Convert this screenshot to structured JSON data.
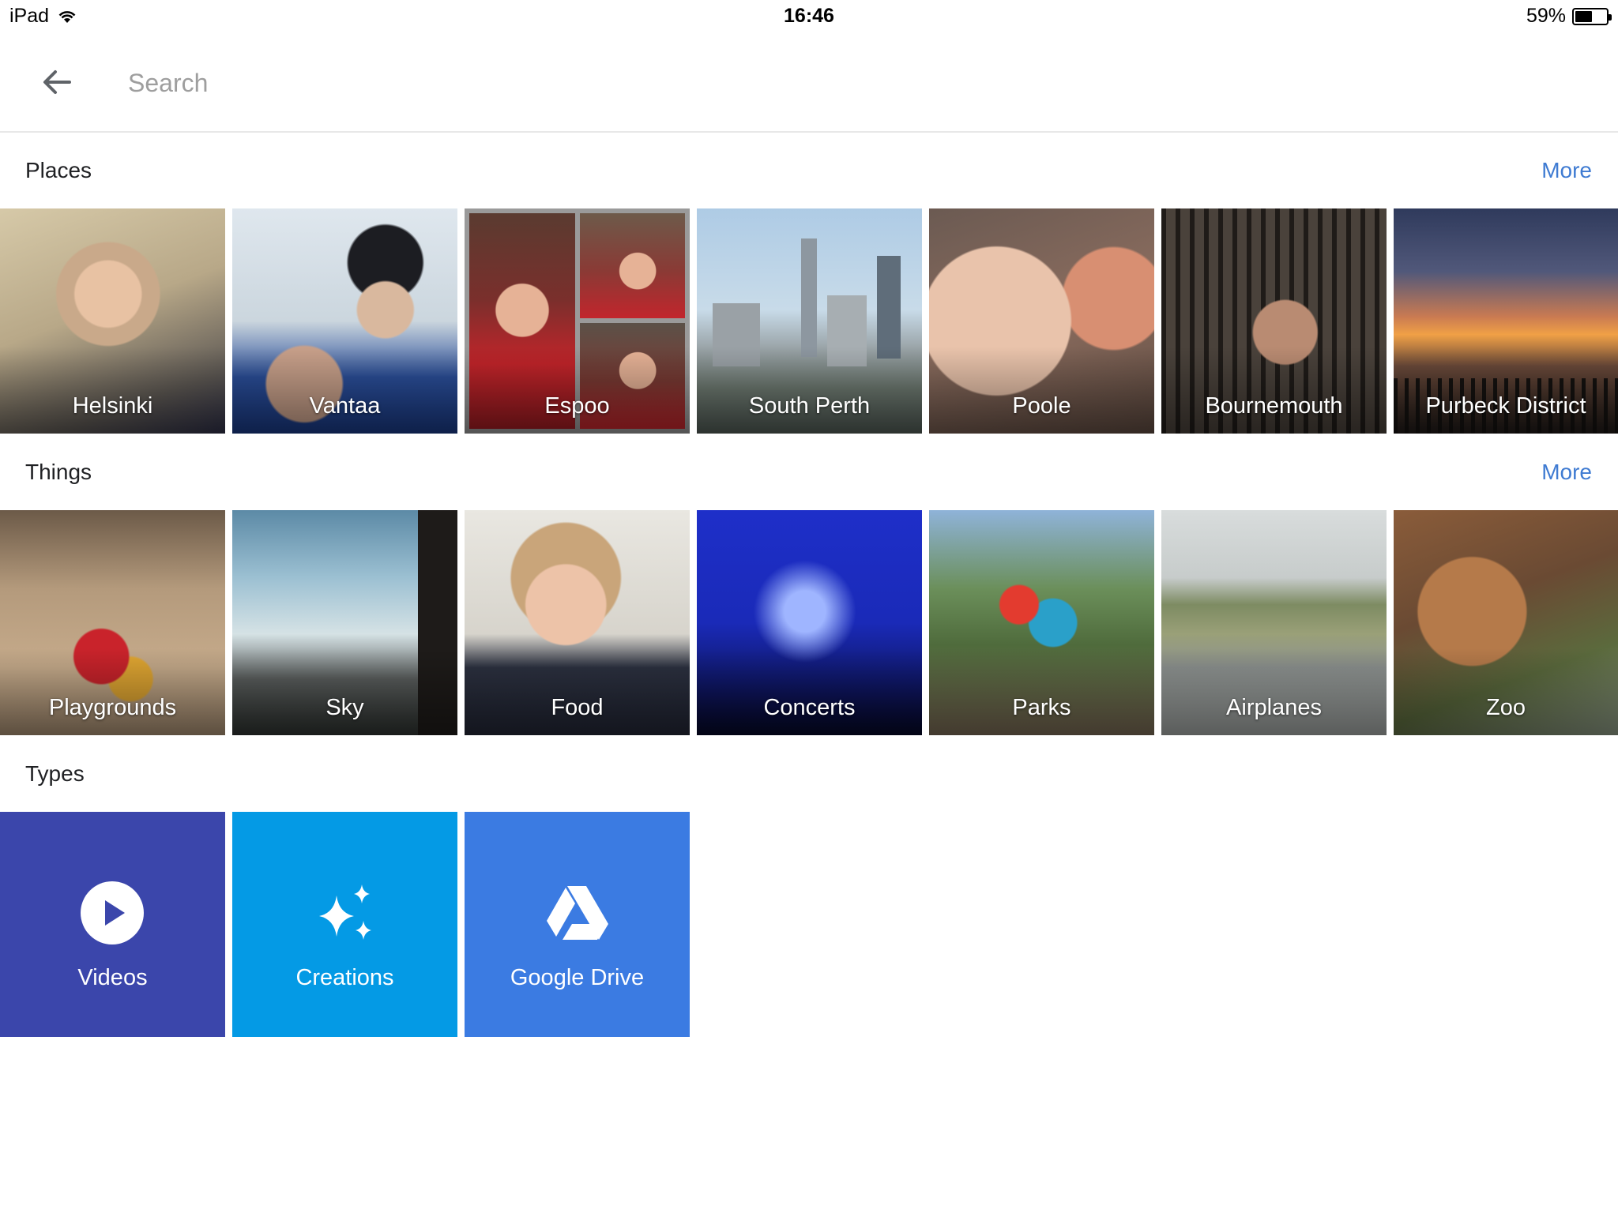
{
  "status_bar": {
    "device": "iPad",
    "time": "16:46",
    "battery_percent_text": "59%",
    "battery_level": 0.59
  },
  "search": {
    "placeholder": "Search"
  },
  "places": {
    "title": "Places",
    "more_label": "More",
    "items": [
      {
        "label": "Helsinki"
      },
      {
        "label": "Vantaa"
      },
      {
        "label": "Espoo"
      },
      {
        "label": "South Perth"
      },
      {
        "label": "Poole"
      },
      {
        "label": "Bournemouth"
      },
      {
        "label": "Purbeck District"
      }
    ]
  },
  "things": {
    "title": "Things",
    "more_label": "More",
    "items": [
      {
        "label": "Playgrounds"
      },
      {
        "label": "Sky"
      },
      {
        "label": "Food"
      },
      {
        "label": "Concerts"
      },
      {
        "label": "Parks"
      },
      {
        "label": "Airplanes"
      },
      {
        "label": "Zoo"
      }
    ]
  },
  "types": {
    "title": "Types",
    "items": [
      {
        "label": "Videos",
        "icon": "play-circle-icon",
        "color": "#3b46ab"
      },
      {
        "label": "Creations",
        "icon": "sparkle-icon",
        "color": "#049ae5"
      },
      {
        "label": "Google Drive",
        "icon": "google-drive-icon",
        "color": "#3b7be2"
      }
    ]
  },
  "colors": {
    "accent": "#3f7bd2"
  }
}
